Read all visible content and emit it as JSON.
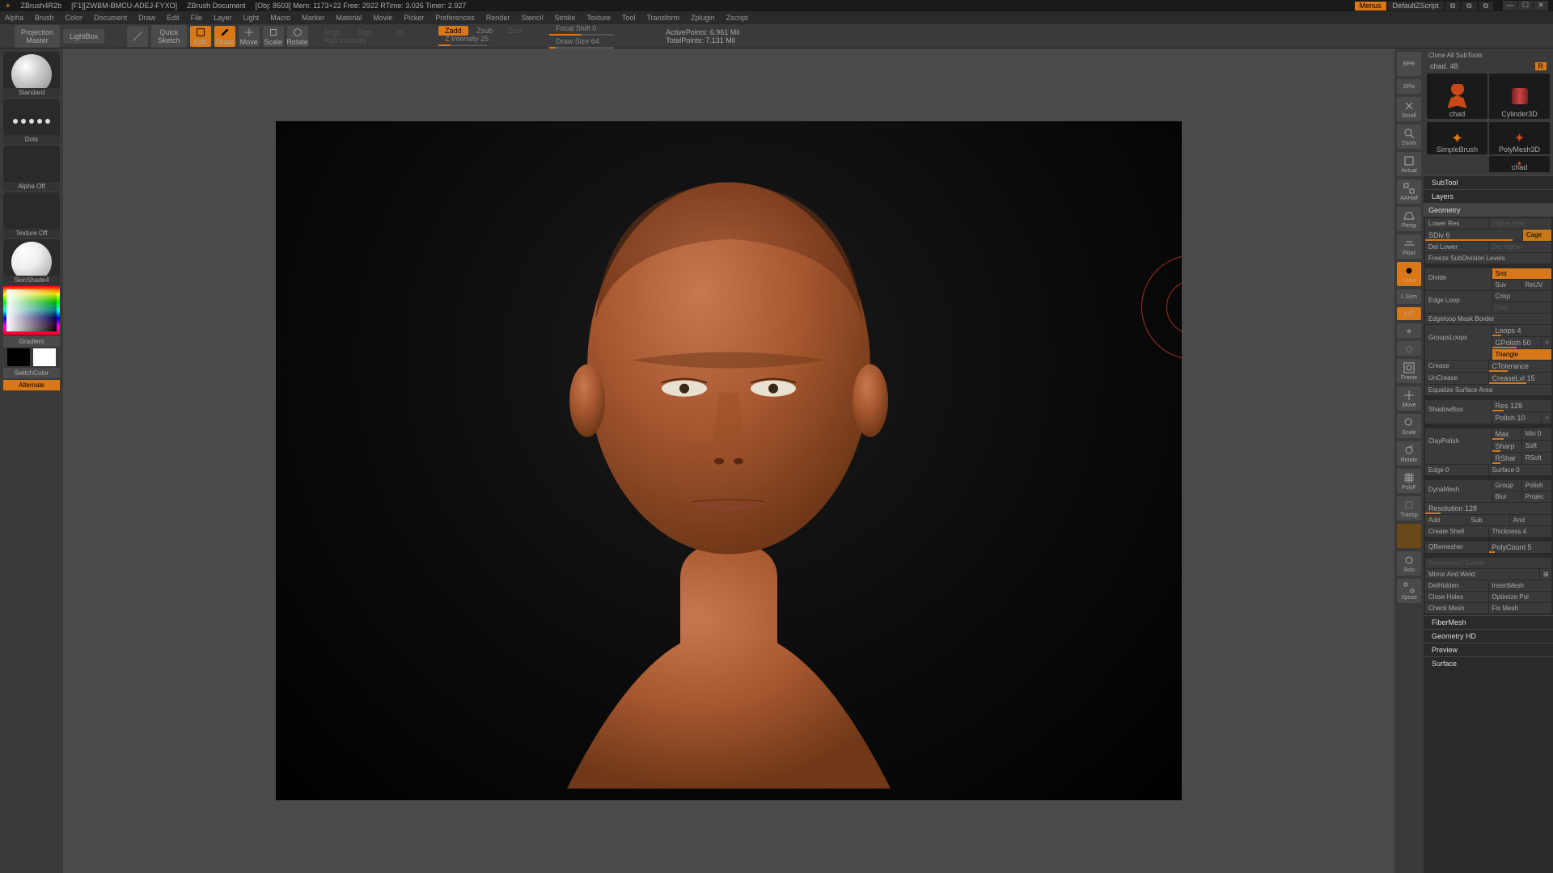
{
  "title": {
    "app": "ZBrush4R2b",
    "file": "[F1][ZWBM-BMCU-ADEJ-FYXO]",
    "doc": "ZBrush Document",
    "obj": "[Obj: 8503] Mem: 1173+22  Free: 2922  RTime: 3.026  Timer: 2.927",
    "menus": "Menus",
    "script": "DefaultZScript"
  },
  "menu": [
    "Alpha",
    "Brush",
    "Color",
    "Document",
    "Draw",
    "Edit",
    "File",
    "Layer",
    "Light",
    "Macro",
    "Marker",
    "Material",
    "Movie",
    "Picker",
    "Preferences",
    "Render",
    "Stencil",
    "Stroke",
    "Texture",
    "Tool",
    "Transform",
    "Zplugin",
    "Zscript"
  ],
  "toolbar": {
    "proj": "Projection\nMaster",
    "lightbox": "LightBox",
    "quicksketch": "Quick\nSketch",
    "edit": "Edit",
    "draw": "Draw",
    "move": "Move",
    "scale": "Scale",
    "rotate": "Rotate",
    "mrgb": "Mrgb",
    "rgb": "Rgb",
    "m": "M",
    "rgbint": "Rgb Intensity",
    "zadd": "Zadd",
    "zsub": "Zsub",
    "zcut": "Zcut",
    "zint": "Z Intensity 25",
    "focal": "Focal Shift 0",
    "drawsize": "Draw Size 64",
    "active": "ActivePoints: 6.961  Mil",
    "total": "TotalPoints: 7.131  Mil"
  },
  "left": {
    "brush": "Standard",
    "stroke": "Dots",
    "alpha": "Alpha  Off",
    "texture": "Texture  Off",
    "material": "SkinShade4",
    "gradient": "Gradient",
    "switch": "SwitchColor",
    "alternate": "Alternate"
  },
  "rstrip": {
    "bpr": "BPR",
    "spix": "SPix",
    "scroll": "Scroll",
    "zoom": "Zoom",
    "actual": "Actual",
    "aahalf": "AAHalf",
    "persp": "Persp",
    "floor": "Floor",
    "local": "Local",
    "lsym": "L.Sym",
    "xyz": "XYZ",
    "frame": "Frame",
    "move": "Move",
    "scale": "Scale",
    "rotate": "Rotate",
    "polyf": "PolyF",
    "transp": "Transp",
    "solo": "Solo",
    "xpose": "Xpose"
  },
  "tools": {
    "clone": "Clone  All  SubTools",
    "name": "chad. 48",
    "r": "R",
    "slot1": "chad",
    "slot2": "Cylinder3D",
    "slot3": "SimpleBrush",
    "slot4": "chad",
    "slot_poly": "PolyMesh3D"
  },
  "sections": {
    "subtool": "SubTool",
    "layers": "Layers",
    "geometry": "Geometry",
    "fibermesh": "FiberMesh",
    "geomhd": "Geometry HD",
    "preview": "Preview",
    "surface": "Surface"
  },
  "geom": {
    "lower": "Lower  Res",
    "higher": "Higher  Res",
    "sdiv": "SDiv 6",
    "cage": "Cage",
    "dellower": "Del  Lower",
    "delhigher": "Del  Higher",
    "freeze": "Freeze  SubDivision  Levels",
    "divide": "Divide",
    "smt": "Smt",
    "suv": "Suv",
    "reuv": "ReUV",
    "crisp": "Crisp",
    "disp": "Disp",
    "edgeloop": "Edge  Loop",
    "edgemask": "Edgeloop  Mask  Border",
    "grouploops": "GroupsLoops",
    "loops": "Loops 4",
    "gpolish": "GPolish 50",
    "triangle": "Triangle",
    "crease": "Crease",
    "ctol": "CTolerance",
    "uncrease": "UnCrease",
    "creaselvl": "CreaseLvl 15",
    "eqsurf": "Equalize  Surface  Area",
    "shadowbox": "ShadowBox",
    "res128": "Res 128",
    "polish": "Polish 10",
    "claypolish": "ClayPolish",
    "max": "Max",
    "min": "Min 0",
    "sharp": "Sharp",
    "soft": "Soft",
    "rshar": "RShar",
    "rsoft": "RSoft",
    "edge0": "Edge 0",
    "surf0": "Surface 0",
    "dynamesh": "DynaMesh",
    "group": "Group",
    "polishd": "Polish",
    "blur": "Blur",
    "project": "Projec",
    "resolution": "Resolution 128",
    "add": "Add",
    "sub": "Sub",
    "and": "And",
    "createshell": "Create  Shell",
    "thickness": "Thickness 4",
    "qremesh": "QRemesher",
    "polycount": "PolyCount 5",
    "reconstruct": "Reconstruct  Subdiv",
    "mirror": "Mirror  And  Weld",
    "delhidden": "DelHidden",
    "insertmesh": "InsertMesh",
    "closeholes": "Close  Holes",
    "optpoly": "Optimize  Pol",
    "checkmesh": "Check  Mesh",
    "fixmesh": "Fix  Mesh"
  }
}
